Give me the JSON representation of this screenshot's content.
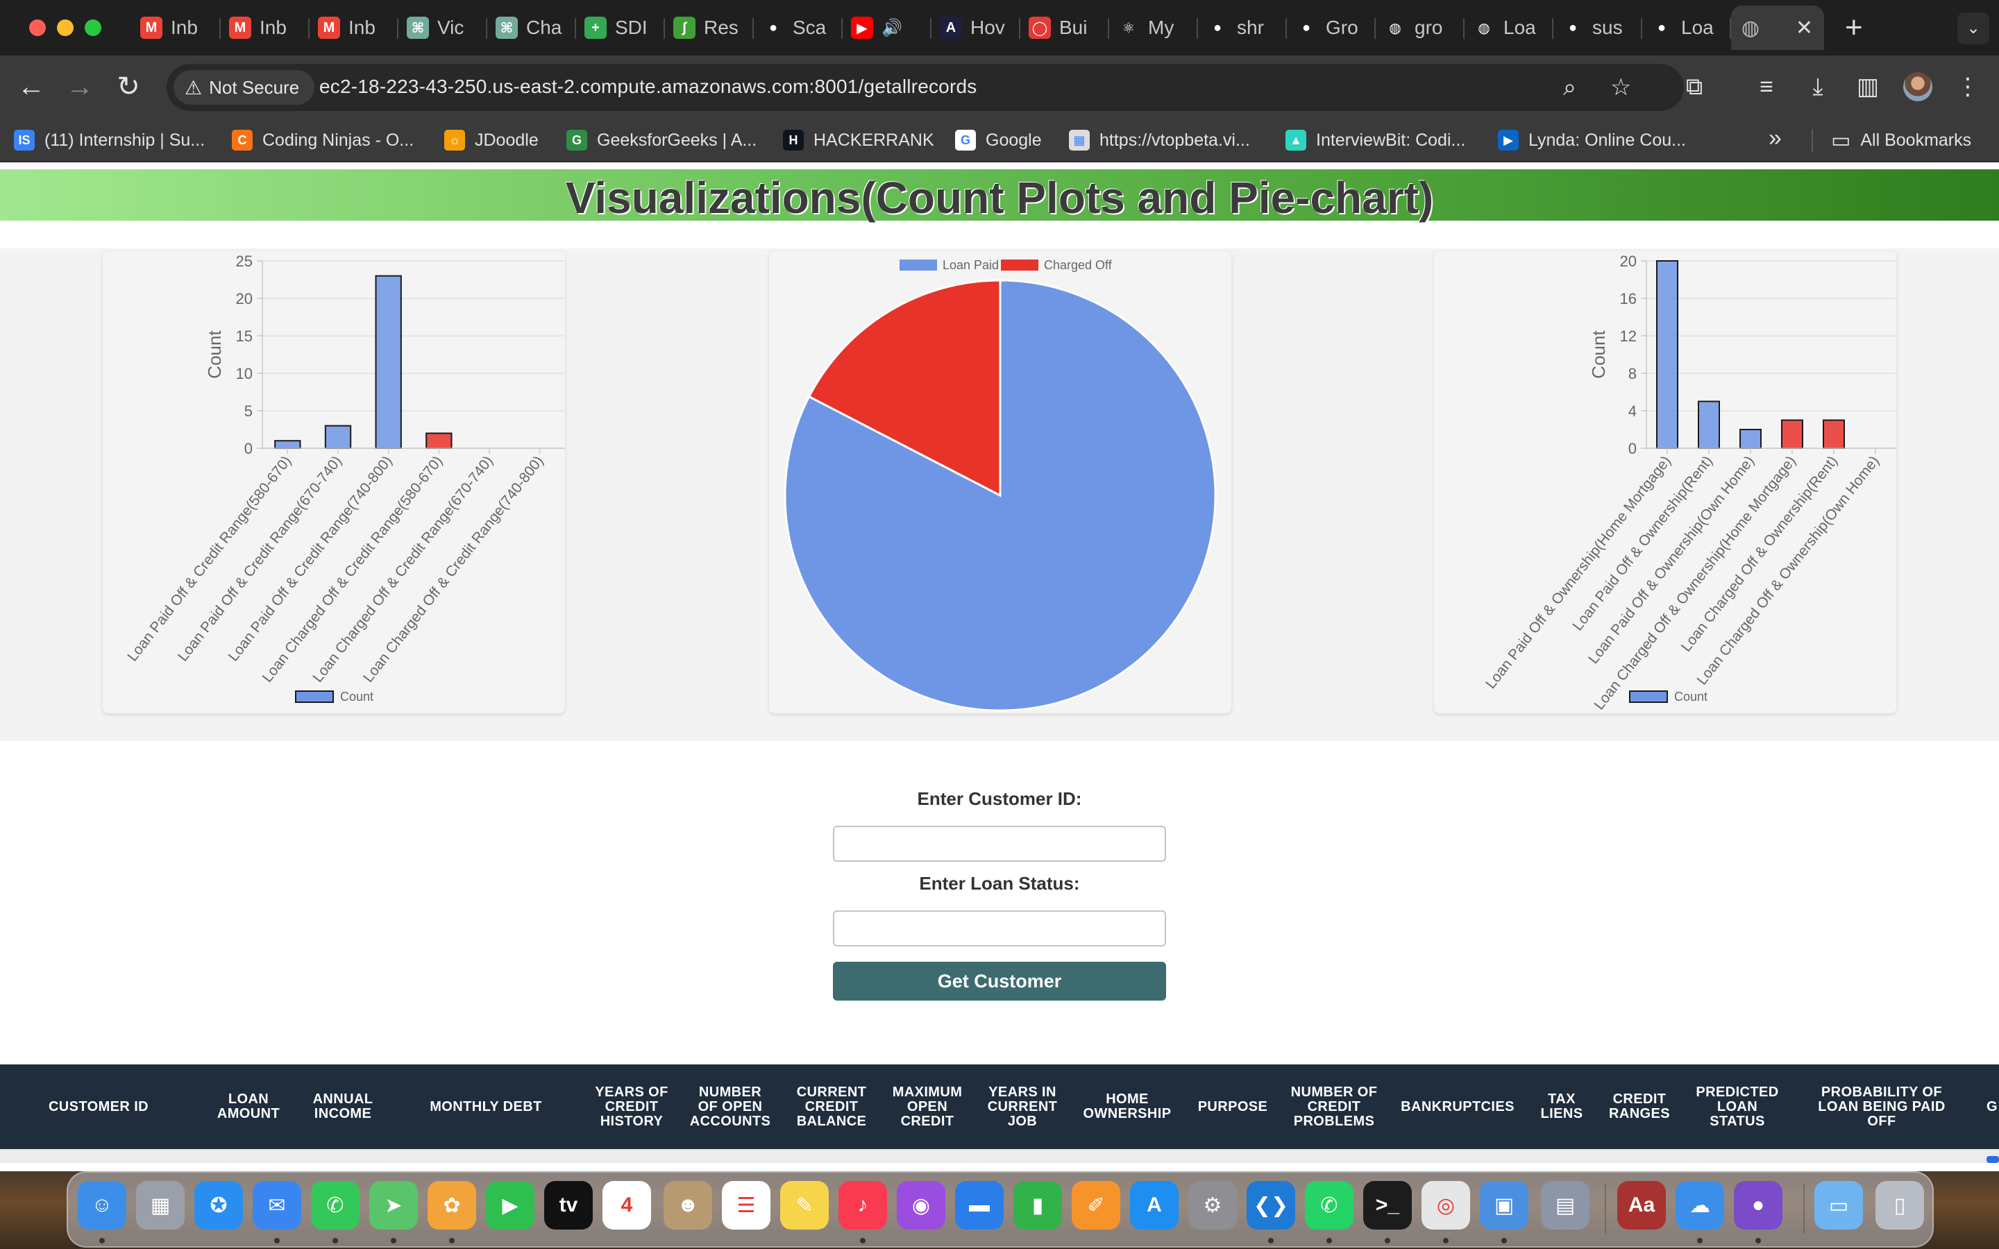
{
  "browser": {
    "tabs": [
      {
        "title": "Inb",
        "icon": "gmail-icon",
        "color": "#ea4335",
        "glyph": "M"
      },
      {
        "title": "Inb",
        "icon": "gmail-icon",
        "color": "#ea4335",
        "glyph": "M"
      },
      {
        "title": "Inb",
        "icon": "gmail-icon",
        "color": "#ea4335",
        "glyph": "M"
      },
      {
        "title": "Vic",
        "icon": "chatgpt-icon",
        "color": "#74aa9c",
        "glyph": "⌘"
      },
      {
        "title": "Cha",
        "icon": "chatgpt-icon",
        "color": "#74aa9c",
        "glyph": "⌘"
      },
      {
        "title": "SDI",
        "icon": "sheets-icon",
        "color": "#34a853",
        "glyph": "+"
      },
      {
        "title": "Res",
        "icon": "mongodb-icon",
        "color": "#3fa037",
        "glyph": "∫"
      },
      {
        "title": "Sca",
        "icon": "github-icon",
        "color": "#1f1f1f",
        "glyph": "●"
      },
      {
        "title": "",
        "icon": "youtube-icon",
        "color": "#ff0000",
        "glyph": "▶"
      },
      {
        "title": "Hov",
        "icon": "appwrite-icon",
        "color": "#1e1e3f",
        "glyph": "A"
      },
      {
        "title": "Bui",
        "icon": "build-icon",
        "color": "#e53935",
        "glyph": "◯"
      },
      {
        "title": "My",
        "icon": "react-icon",
        "color": "#1f1f1f",
        "glyph": "⚛"
      },
      {
        "title": "shr",
        "icon": "github-icon",
        "color": "#1f1f1f",
        "glyph": "●"
      },
      {
        "title": "Gro",
        "icon": "github-icon",
        "color": "#1f1f1f",
        "glyph": "●"
      },
      {
        "title": "gro",
        "icon": "globe-icon",
        "color": "#1f1f1f",
        "glyph": "◍"
      },
      {
        "title": "Loa",
        "icon": "globe-icon",
        "color": "#1f1f1f",
        "glyph": "◍"
      },
      {
        "title": "sus",
        "icon": "github-icon",
        "color": "#1f1f1f",
        "glyph": "●"
      },
      {
        "title": "Loa",
        "icon": "github-icon",
        "color": "#1f1f1f",
        "glyph": "●"
      }
    ],
    "active_tab": {
      "title": "",
      "icon": "globe-icon"
    },
    "security_label": "Not Secure",
    "url": "ec2-18-223-43-250.us-east-2.compute.amazonaws.com:8001/getallrecords",
    "bookmarks": [
      {
        "label": "(11) Internship | Su...",
        "icon": "internshala-icon",
        "color": "#3b82f6",
        "glyph": "IS"
      },
      {
        "label": "Coding Ninjas - O...",
        "icon": "codingninjas-icon",
        "color": "#f97316",
        "glyph": "C"
      },
      {
        "label": "JDoodle",
        "icon": "jdoodle-icon",
        "color": "#f59e0b",
        "glyph": "☼"
      },
      {
        "label": "GeeksforGeeks | A...",
        "icon": "gfg-icon",
        "color": "#2f8d46",
        "glyph": "G"
      },
      {
        "label": "HACKERRANK",
        "icon": "hackerrank-icon",
        "color": "#0e141e",
        "glyph": "H"
      },
      {
        "label": "Google",
        "icon": "google-icon",
        "color": "#ffffff",
        "glyph": "G"
      },
      {
        "label": "https://vtopbeta.vi...",
        "icon": "vtop-icon",
        "color": "#dddddd",
        "glyph": "▦"
      },
      {
        "label": "InterviewBit: Codi...",
        "icon": "interviewbit-icon",
        "color": "#2dd4bf",
        "glyph": "▲"
      },
      {
        "label": "Lynda: Online Cou...",
        "icon": "lynda-icon",
        "color": "#0a66c2",
        "glyph": "▶"
      }
    ],
    "all_bookmarks_label": "All Bookmarks"
  },
  "page": {
    "viz_title": "Visualizations(Count Plots and Pie-chart)",
    "form": {
      "customer_id_label": "Enter Customer ID:",
      "customer_id_value": "",
      "loan_status_label": "Enter Loan Status:",
      "loan_status_value": "",
      "submit_label": "Get Customer"
    },
    "table_headers": [
      "Customer ID",
      "Loan Amount",
      "Annual Income",
      "Monthly Debt",
      "Years of Credit History",
      "Number of Open Accounts",
      "Current Credit Balance",
      "Maximum Open Credit",
      "Years in Current Job",
      "Home Ownership",
      "Purpose",
      "Number of Credit Problems",
      "Bankruptcies",
      "Tax Liens",
      "Credit Ranges",
      "Predicted Loan Status",
      "Probability of Loan Being Paid Off",
      "G"
    ]
  },
  "colors": {
    "paid": "#6f96e4",
    "charged": "#e8332a",
    "button": "#3e6b70",
    "table_header": "#1f2d3d"
  },
  "chart_data": [
    {
      "type": "bar",
      "categories": [
        "Loan Paid Off & Credit Range(580-670)",
        "Loan Paid Off & Credit Range(670-740)",
        "Loan Paid Off & Credit Range(740-800)",
        "Loan Charged Off & Credit Range(580-670)",
        "Loan Charged Off & Credit Range(670-740)",
        "Loan Charged Off & Credit Range(740-800)"
      ],
      "values": [
        1,
        3,
        23,
        2,
        0,
        0
      ],
      "bar_colors": [
        "#6f96e4",
        "#6f96e4",
        "#6f96e4",
        "#e8332a",
        "#e8332a",
        "#e8332a"
      ],
      "ylabel": "Count",
      "ylim": [
        0,
        25
      ],
      "yticks": [
        0,
        5,
        10,
        15,
        20,
        25
      ],
      "legend": [
        "Count"
      ],
      "legend_position": "bottom"
    },
    {
      "type": "pie",
      "labels": [
        "Loan Paid",
        "Charged Off"
      ],
      "values": [
        82.6,
        17.4
      ],
      "colors": [
        "#6f96e4",
        "#e8332a"
      ],
      "legend_position": "top"
    },
    {
      "type": "bar",
      "categories": [
        "Loan Paid Off & Ownership(Home Mortgage)",
        "Loan Paid Off & Ownership(Rent)",
        "Loan Paid Off & Ownership(Own Home)",
        "Loan Charged Off & Ownership(Home Mortgage)",
        "Loan Charged Off & Ownership(Rent)",
        "Loan Charged Off & Ownership(Own Home)"
      ],
      "values": [
        20,
        5,
        2,
        3,
        3,
        0
      ],
      "bar_colors": [
        "#6f96e4",
        "#6f96e4",
        "#6f96e4",
        "#e8332a",
        "#e8332a",
        "#e8332a"
      ],
      "ylabel": "Count",
      "ylim": [
        0,
        20
      ],
      "yticks": [
        0,
        4,
        8,
        12,
        16,
        20
      ],
      "legend": [
        "Count"
      ],
      "legend_position": "bottom"
    }
  ],
  "dock": {
    "apps": [
      {
        "name": "finder-icon",
        "color": "#3d8ee8",
        "glyph": "☺"
      },
      {
        "name": "launchpad-icon",
        "color": "#9aa0aa",
        "glyph": "▦"
      },
      {
        "name": "safari-icon",
        "color": "#2a8ef0",
        "glyph": "✪"
      },
      {
        "name": "mail-icon",
        "color": "#3a86f0",
        "glyph": "✉"
      },
      {
        "name": "messages-icon",
        "color": "#34c759",
        "glyph": "✆"
      },
      {
        "name": "maps-icon",
        "color": "#5ac46a",
        "glyph": "➤"
      },
      {
        "name": "photos-icon",
        "color": "#f2a33a",
        "glyph": "✿"
      },
      {
        "name": "facetime-icon",
        "color": "#2fbf50",
        "glyph": "▶"
      },
      {
        "name": "appletv-icon",
        "color": "#111111",
        "glyph": "tv"
      },
      {
        "name": "calendar-icon",
        "color": "#ffffff",
        "glyph": "4"
      },
      {
        "name": "contacts-icon",
        "color": "#b89a72",
        "glyph": "☻"
      },
      {
        "name": "reminders-icon",
        "color": "#ffffff",
        "glyph": "☰"
      },
      {
        "name": "notes-icon",
        "color": "#f7d54a",
        "glyph": "✎"
      },
      {
        "name": "music-icon",
        "color": "#fa3a50",
        "glyph": "♪"
      },
      {
        "name": "podcasts-icon",
        "color": "#9b4de0",
        "glyph": "◉"
      },
      {
        "name": "keynote-icon",
        "color": "#2b7de9",
        "glyph": "▬"
      },
      {
        "name": "numbers-icon",
        "color": "#32b34a",
        "glyph": "▮"
      },
      {
        "name": "pages-icon",
        "color": "#f6942b",
        "glyph": "✐"
      },
      {
        "name": "appstore-icon",
        "color": "#1e8ef0",
        "glyph": "A"
      },
      {
        "name": "settings-icon",
        "color": "#8e8e93",
        "glyph": "⚙"
      },
      {
        "name": "vscode-icon",
        "color": "#1f7ad6",
        "glyph": "❮❯"
      },
      {
        "name": "whatsapp-icon",
        "color": "#25d366",
        "glyph": "✆"
      },
      {
        "name": "terminal-icon",
        "color": "#1c1c1c",
        "glyph": ">_"
      },
      {
        "name": "chrome-icon",
        "color": "#e6e6e6",
        "glyph": "◎"
      },
      {
        "name": "preview-icon",
        "color": "#4a8fe0",
        "glyph": "▣"
      },
      {
        "name": "photobooth-icon",
        "color": "#8c96a8",
        "glyph": "▤"
      },
      {
        "name": "dictionary-icon",
        "color": "#a8322f",
        "glyph": "Aa"
      },
      {
        "name": "weather-icon",
        "color": "#3b8fe8",
        "glyph": "☁"
      },
      {
        "name": "github-desktop-icon",
        "color": "#7b4bc9",
        "glyph": "●"
      },
      {
        "name": "folder-icon",
        "color": "#6fb4f0",
        "glyph": "▭"
      },
      {
        "name": "trash-icon",
        "color": "#b8bcc4",
        "glyph": "▯"
      }
    ]
  }
}
